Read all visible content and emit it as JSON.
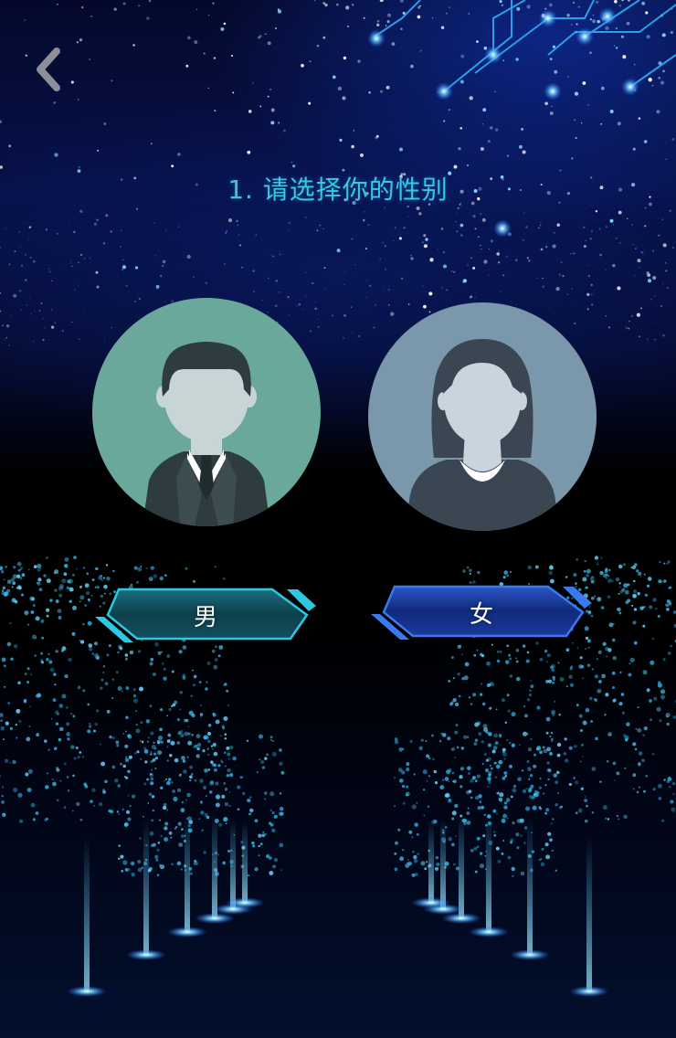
{
  "header": {
    "back_icon": "chevron-left-icon"
  },
  "question": {
    "title": "1. 请选择你的性别"
  },
  "options": [
    {
      "id": "male",
      "label": "男",
      "avatar_icon": "male-avatar-icon",
      "accent": "#2ec8e0",
      "avatar_bg": "#69a89b"
    },
    {
      "id": "female",
      "label": "女",
      "avatar_icon": "female-avatar-icon",
      "accent": "#3c78f0",
      "avatar_bg": "#7a97ab"
    }
  ],
  "colors": {
    "title": "#34c9e6",
    "background_top": "#071149",
    "background_bottom": "#000000"
  }
}
